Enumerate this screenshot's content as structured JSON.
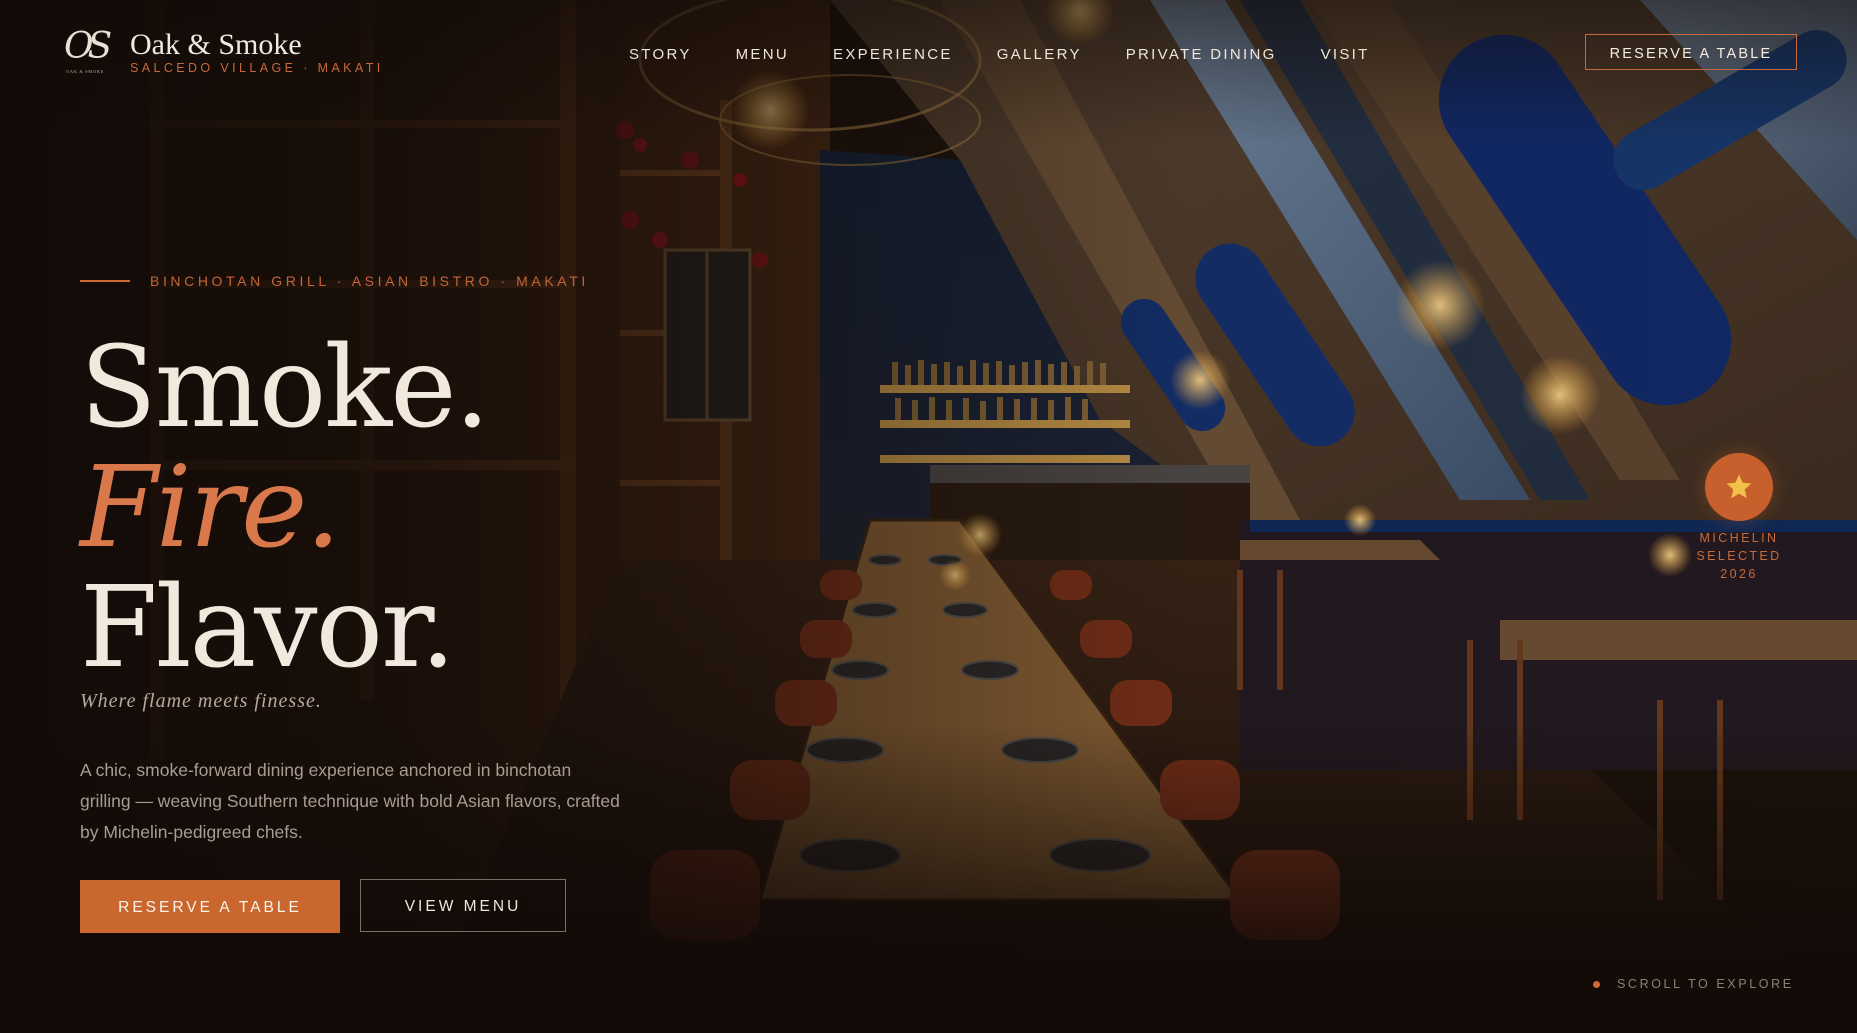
{
  "brand": {
    "monogram": "OS",
    "monogram_caption": "OAK & SMOKE",
    "name": "Oak & Smoke",
    "subtitle": "SALCEDO VILLAGE · MAKATI"
  },
  "nav": {
    "items": [
      {
        "label": "STORY"
      },
      {
        "label": "MENU"
      },
      {
        "label": "EXPERIENCE"
      },
      {
        "label": "GALLERY"
      },
      {
        "label": "PRIVATE DINING"
      },
      {
        "label": "VISIT"
      }
    ],
    "cta_label": "RESERVE A TABLE"
  },
  "hero": {
    "eyebrow": "BINCHOTAN GRILL · ASIAN BISTRO · MAKATI",
    "headline_line1": "Smoke.",
    "headline_line2": "Fire.",
    "headline_line3": "Flavor.",
    "tagline": "Where flame meets finesse.",
    "description": "A chic, smoke-forward dining experience anchored in binchotan grilling — weaving Southern technique with bold Asian flavors, crafted by Michelin-pedigreed chefs.",
    "primary_button": "RESERVE A TABLE",
    "secondary_button": "VIEW MENU"
  },
  "badge": {
    "icon": "star-icon",
    "line1": "MICHELIN",
    "line2": "SELECTED",
    "line3": "2026"
  },
  "scroll_hint": "SCROLL TO EXPLORE",
  "colors": {
    "accent": "#c9672f",
    "accent_text": "#d9784a",
    "background": "#140d09",
    "text": "#f0e7dc",
    "muted": "#a79c90"
  }
}
